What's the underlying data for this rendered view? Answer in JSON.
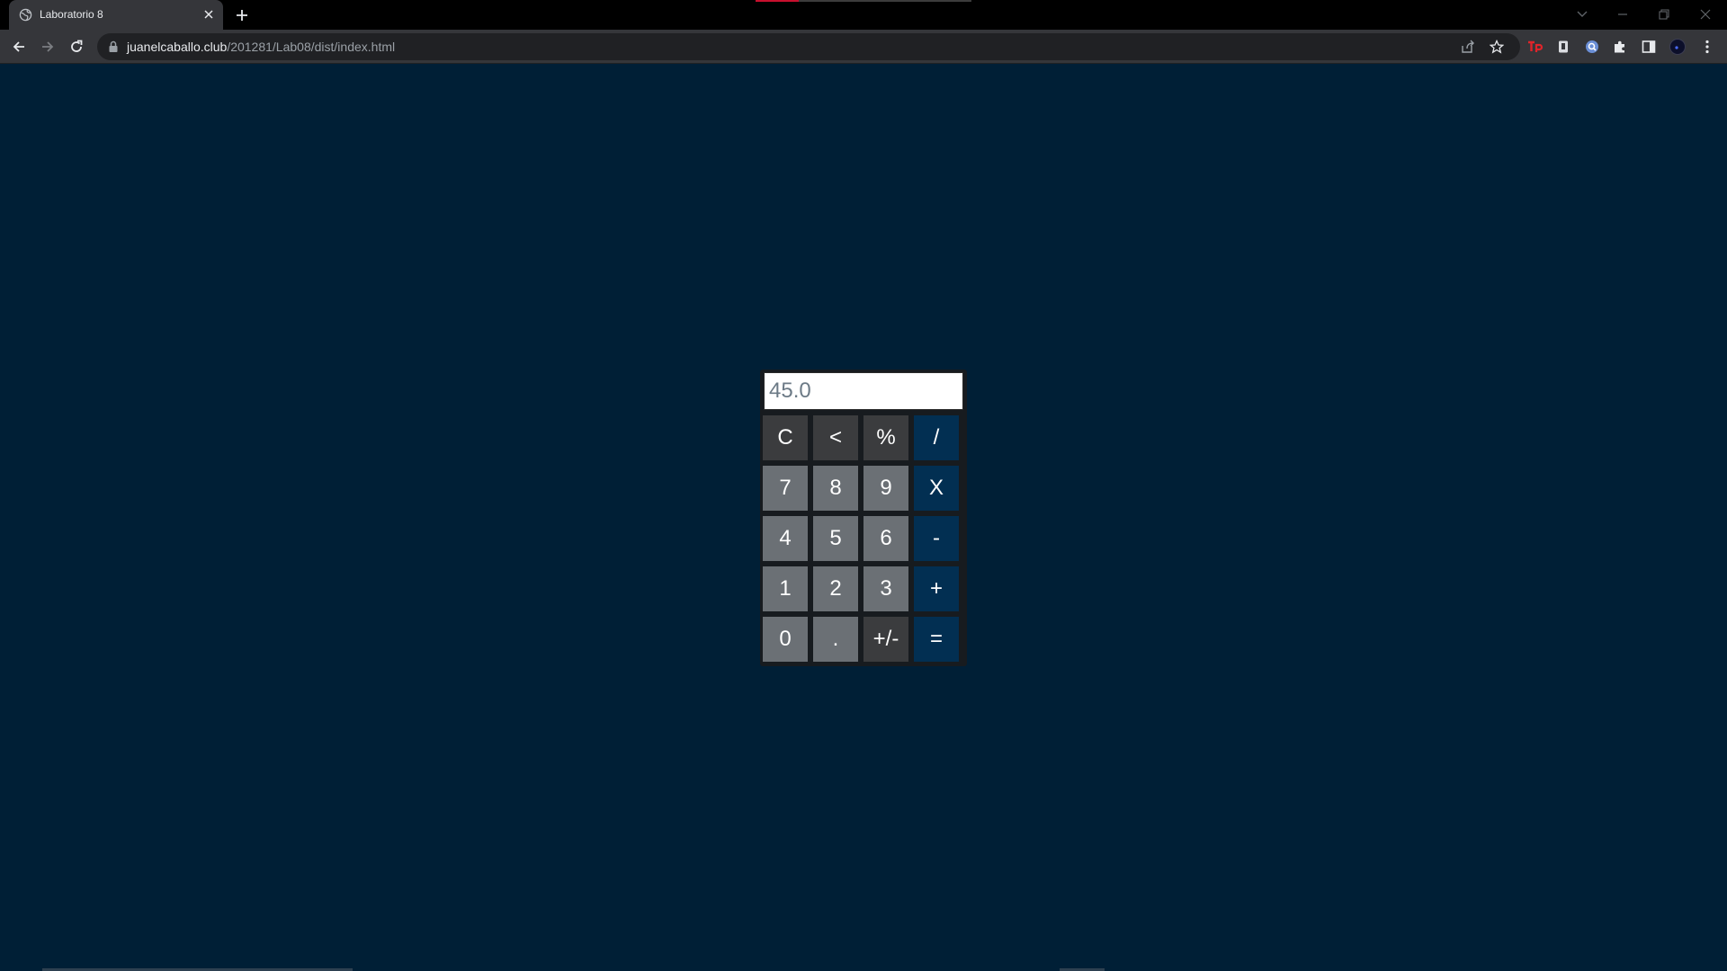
{
  "browser": {
    "tab_title": "Laboratorio 8",
    "url_host": "juanelcaballo.club",
    "url_path": "/201281/Lab08/dist/index.html"
  },
  "calculator": {
    "display_value": "45.0",
    "rows": [
      [
        {
          "label": "C",
          "kind": "func"
        },
        {
          "label": "<",
          "kind": "func"
        },
        {
          "label": "%",
          "kind": "func"
        },
        {
          "label": "/",
          "kind": "op"
        }
      ],
      [
        {
          "label": "7",
          "kind": "num"
        },
        {
          "label": "8",
          "kind": "num"
        },
        {
          "label": "9",
          "kind": "num"
        },
        {
          "label": "X",
          "kind": "op"
        }
      ],
      [
        {
          "label": "4",
          "kind": "num"
        },
        {
          "label": "5",
          "kind": "num"
        },
        {
          "label": "6",
          "kind": "num"
        },
        {
          "label": "-",
          "kind": "op"
        }
      ],
      [
        {
          "label": "1",
          "kind": "num"
        },
        {
          "label": "2",
          "kind": "num"
        },
        {
          "label": "3",
          "kind": "num"
        },
        {
          "label": "+",
          "kind": "op"
        }
      ],
      [
        {
          "label": "0",
          "kind": "num"
        },
        {
          "label": ".",
          "kind": "num"
        },
        {
          "label": "+/-",
          "kind": "func"
        },
        {
          "label": "=",
          "kind": "op"
        }
      ]
    ]
  },
  "colors": {
    "page_background": "#001f36",
    "digit_key": "#6b7075",
    "function_key": "#3b3c3e",
    "operator_key": "#022f52"
  }
}
